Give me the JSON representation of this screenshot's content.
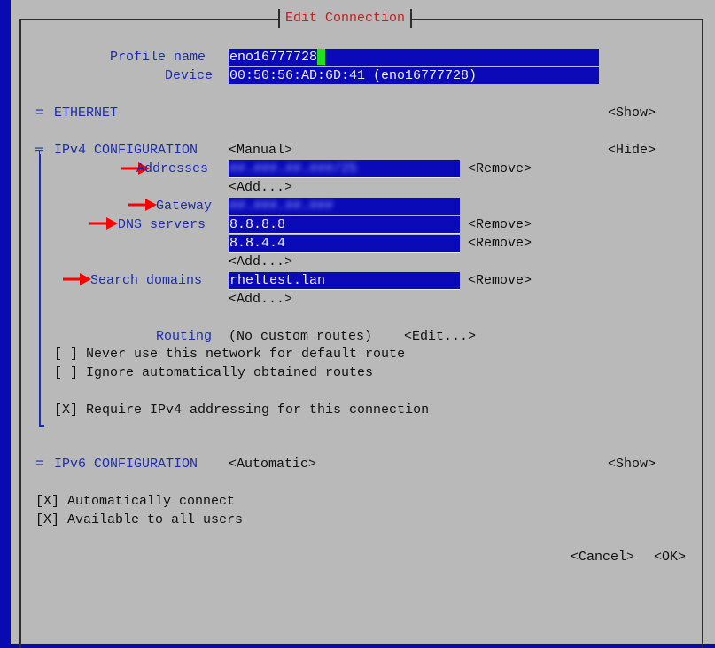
{
  "window_title": "Edit Connection",
  "profile": {
    "name_label": "Profile name",
    "name_value": "eno16777728",
    "device_label": "Device",
    "device_value": "00:50:56:AD:6D:41 (eno16777728)"
  },
  "ethernet": {
    "marker": "=",
    "label": "ETHERNET",
    "toggle": "<Show>"
  },
  "ipv4": {
    "marker": "╤",
    "label": "IPv4 CONFIGURATION",
    "mode": "<Manual>",
    "toggle": "<Hide>",
    "addresses_label": "Addresses",
    "address_value": "##.###.##.###/25",
    "gateway_label": "Gateway",
    "gateway_value": "##.###.##.###",
    "dns_label": "DNS servers",
    "dns_1": "8.8.8.8",
    "dns_2": "8.8.4.4",
    "search_label": "Search domains",
    "search_value": "rheltest.lan",
    "add": "<Add...>",
    "remove": "<Remove>",
    "routing_label": "Routing",
    "routing_value": "(No custom routes)",
    "routing_edit": "<Edit...>",
    "never_default": "[ ] Never use this network for default route",
    "ignore_routes": "[ ] Ignore automatically obtained routes",
    "require_ipv4": "[X] Require IPv4 addressing for this connection"
  },
  "ipv6": {
    "marker": "=",
    "label": "IPv6 CONFIGURATION",
    "mode": "<Automatic>",
    "toggle": "<Show>"
  },
  "auto_connect": "[X] Automatically connect",
  "all_users": "[X] Available to all users",
  "buttons": {
    "cancel": "<Cancel>",
    "ok": "<OK>"
  },
  "colors": {
    "background": "#0a0ab2",
    "panel": "#b9b9b9",
    "field": "#0a0ab8",
    "label": "#1a2db0",
    "title": "#c02020",
    "cursor": "#21e021",
    "annotation_arrow": "#ff0000"
  }
}
